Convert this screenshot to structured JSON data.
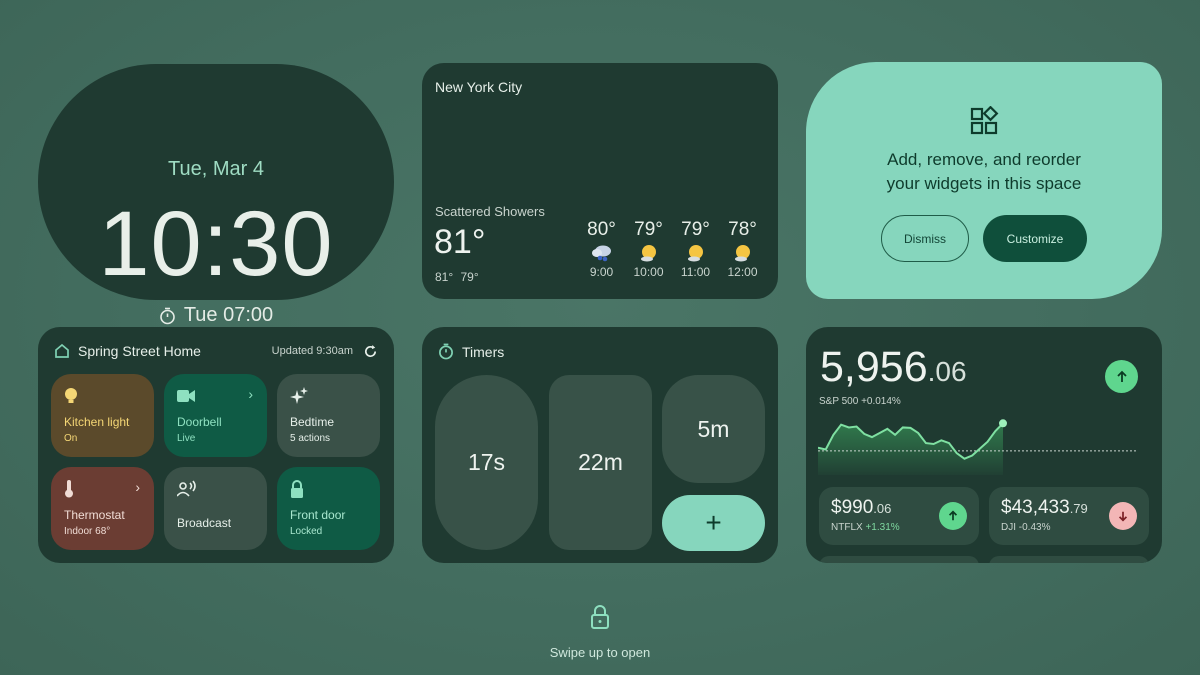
{
  "clock": {
    "date": "Tue, Mar 4",
    "time": "10:30",
    "alarm": "Tue 07:00",
    "alarm_icon": "stopwatch-icon"
  },
  "weather": {
    "city": "New York City",
    "condition": "Scattered Showers",
    "current_temp": "81°",
    "high_low": "81° 79°",
    "hourly": [
      {
        "temp": "80°",
        "hour": "9:00",
        "icon": "rain-cloud-icon"
      },
      {
        "temp": "79°",
        "hour": "10:00",
        "icon": "partly-sunny-icon"
      },
      {
        "temp": "79°",
        "hour": "11:00",
        "icon": "partly-sunny-icon"
      },
      {
        "temp": "78°",
        "hour": "12:00",
        "icon": "partly-sunny-icon"
      }
    ]
  },
  "customize": {
    "icon": "widgets-icon",
    "message_line1": "Add, remove, and reorder",
    "message_line2": "your widgets in this space",
    "dismiss_label": "Dismiss",
    "customize_label": "Customize"
  },
  "home": {
    "title": "Spring Street Home",
    "updated": "Updated 9:30am",
    "tiles": [
      {
        "name": "Kitchen light",
        "sub": "On",
        "icon": "lightbulb-icon",
        "chevron": false
      },
      {
        "name": "Doorbell",
        "sub": "Live",
        "icon": "video-camera-icon",
        "chevron": true
      },
      {
        "name": "Bedtime",
        "sub": "5 actions",
        "icon": "sparkle-icon",
        "chevron": false
      },
      {
        "name": "Thermostat",
        "sub": "Indoor 68°",
        "icon": "thermometer-icon",
        "chevron": true
      },
      {
        "name": "Broadcast",
        "sub": "",
        "icon": "broadcast-icon",
        "chevron": false
      },
      {
        "name": "Front door",
        "sub": "Locked",
        "icon": "lock-icon",
        "chevron": false
      }
    ]
  },
  "timers": {
    "title": "Timers",
    "items": [
      "17s",
      "22m",
      "5m"
    ],
    "add_label": "+"
  },
  "stocks": {
    "main_int": "5,956",
    "main_dec": ".06",
    "main_label": "S&P 500 +0.014%",
    "main_trend": "up",
    "tickers": [
      {
        "int": "$990",
        "dec": ".06",
        "symbol": "NTFLX",
        "change": "+1.31%",
        "trend": "up"
      },
      {
        "int": "$43,433",
        "dec": ".79",
        "symbol": "DJI",
        "change": "-0.43%",
        "trend": "down"
      }
    ],
    "sparkline": [
      0.42,
      0.38,
      0.7,
      0.92,
      0.86,
      0.88,
      0.72,
      0.65,
      0.74,
      0.83,
      0.7,
      0.86,
      0.85,
      0.74,
      0.52,
      0.5,
      0.58,
      0.52,
      0.3,
      0.18,
      0.25,
      0.4,
      0.55,
      0.78,
      0.95
    ]
  },
  "colors": {
    "accent": "#86d6bd",
    "card": "#1f3a31",
    "up": "#5fd68e",
    "down": "#f3b6b6"
  },
  "footer": {
    "swipe_label": "Swipe up to open",
    "icon": "lock-icon"
  }
}
